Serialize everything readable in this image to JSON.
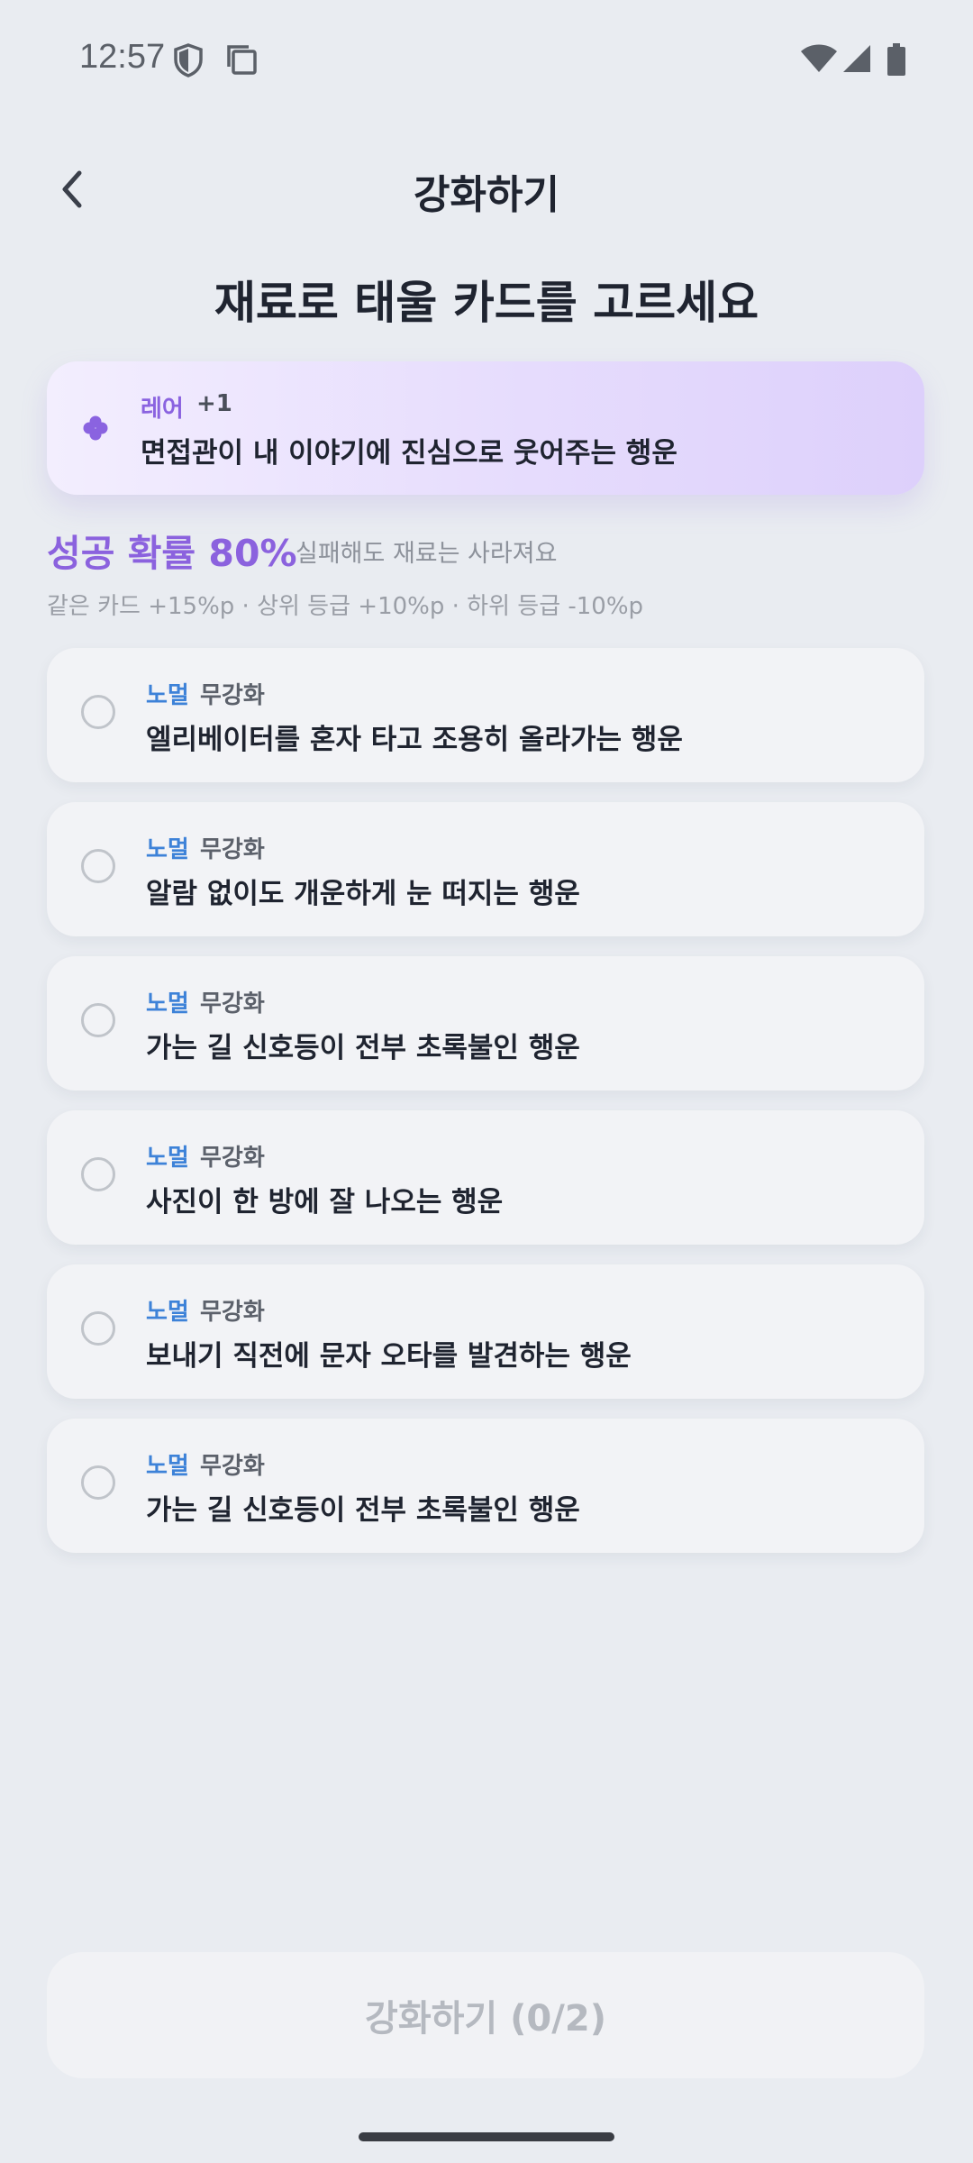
{
  "status_bar": {
    "time": "12:57"
  },
  "header": {
    "title": "강화하기"
  },
  "headline": "재료로 태울 카드를 고르세요",
  "selected_card": {
    "rarity": "레어",
    "level": "+1",
    "title": "면접관이 내 이야기에 진심으로 웃어주는 행운"
  },
  "probability": {
    "text": "성공 확률 80%",
    "note": "실패해도 재료는 사라져요",
    "bonus_rule": "같은 카드 +15%p · 상위 등급 +10%p · 하위 등급 -10%p"
  },
  "options": [
    {
      "rarity": "노멀",
      "level": "무강화",
      "title": "엘리베이터를 혼자 타고 조용히 올라가는 행운"
    },
    {
      "rarity": "노멀",
      "level": "무강화",
      "title": "알람 없이도 개운하게 눈 떠지는 행운"
    },
    {
      "rarity": "노멀",
      "level": "무강화",
      "title": "가는 길 신호등이 전부 초록불인 행운"
    },
    {
      "rarity": "노멀",
      "level": "무강화",
      "title": "사진이 한 방에 잘 나오는 행운"
    },
    {
      "rarity": "노멀",
      "level": "무강화",
      "title": "보내기 직전에 문자 오타를 발견하는 행운"
    },
    {
      "rarity": "노멀",
      "level": "무강화",
      "title": "가는 길 신호등이 전부 초록불인 행운"
    }
  ],
  "action_button": {
    "label": "강화하기 (0/2)"
  },
  "colors": {
    "accent_purple": "#8b62de",
    "normal_blue": "#3d82d8",
    "background": "#e9ecf1"
  }
}
